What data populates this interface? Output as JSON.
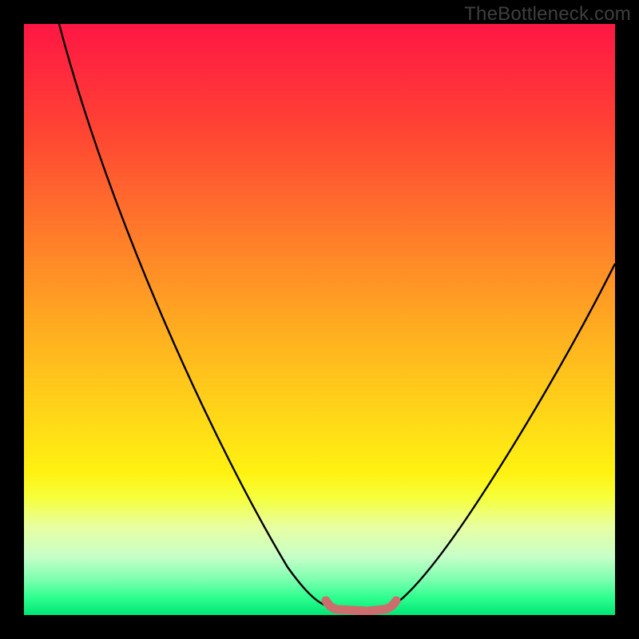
{
  "watermark": "TheBottleneck.com",
  "colors": {
    "page_bg": "#000000",
    "curve": "#000000",
    "flat_segment": "#cc6e6e",
    "gradient_top": "#ff1744",
    "gradient_bottom": "#00e676"
  },
  "chart_data": {
    "type": "line",
    "title": "",
    "xlabel": "",
    "ylabel": "",
    "xlim": [
      0,
      100
    ],
    "ylim": [
      0,
      100
    ],
    "series": [
      {
        "name": "left-curve",
        "x": [
          6,
          10,
          15,
          20,
          25,
          30,
          35,
          40,
          45,
          48,
          50,
          52
        ],
        "y": [
          100,
          90,
          78,
          66,
          55,
          44,
          34,
          25,
          16,
          10,
          6,
          3
        ]
      },
      {
        "name": "flat-bottom",
        "x": [
          52,
          55,
          58,
          60,
          62
        ],
        "y": [
          3,
          2,
          2,
          2,
          3
        ]
      },
      {
        "name": "right-curve",
        "x": [
          62,
          66,
          70,
          75,
          80,
          85,
          90,
          95,
          100
        ],
        "y": [
          3,
          8,
          14,
          22,
          30,
          38,
          46,
          54,
          62
        ]
      }
    ],
    "annotations": [
      {
        "text": "TheBottleneck.com",
        "position": "top-right"
      }
    ]
  }
}
